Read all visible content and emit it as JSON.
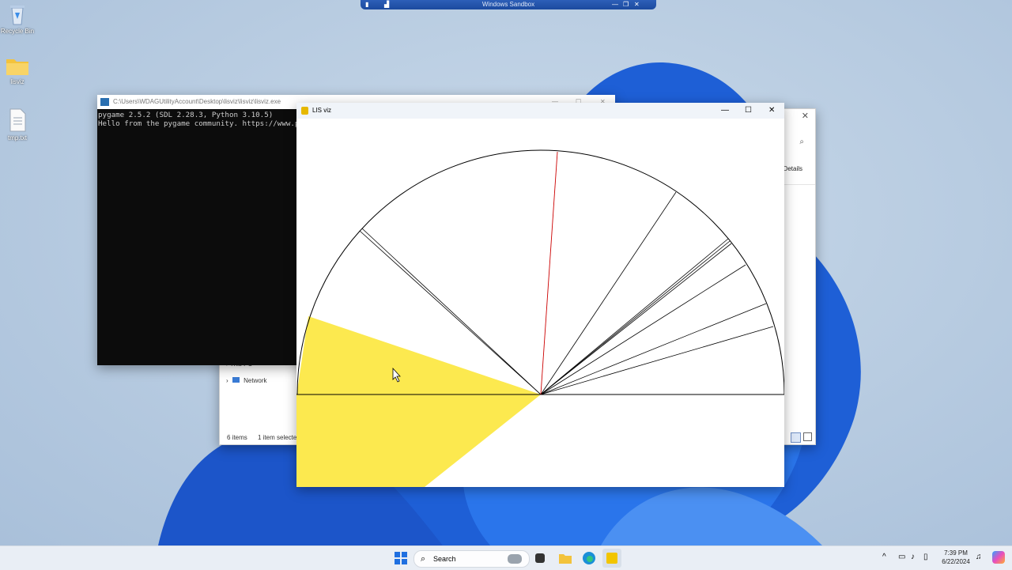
{
  "sandbox": {
    "title": "Windows Sandbox"
  },
  "desktop_icons": [
    {
      "label": "Recycle Bin",
      "icon": "recycle-bin-icon"
    },
    {
      "label": "lisviz",
      "icon": "folder-icon"
    },
    {
      "label": "tmp.txt",
      "icon": "text-file-icon"
    }
  ],
  "console": {
    "title": "C:\\Users\\WDAGUtilityAccount\\Desktop\\lisviz\\lisviz\\lisviz.exe",
    "lines": [
      "pygame 2.5.2 (SDL 2.28.3, Python 3.10.5)",
      "Hello from the pygame community. https://www.py"
    ]
  },
  "explorer": {
    "details_label": "Details",
    "nav_this_pc": "This PC",
    "nav_network": "Network",
    "status_items": "6 items",
    "status_selected": "1 item selecte"
  },
  "pywin": {
    "title": "LIS viz"
  },
  "viz": {
    "center_color": "#fce94f",
    "highlight_color": "#fce94f",
    "red_line_color": "#cc0000"
  },
  "taskbar": {
    "search_placeholder": "Search",
    "time": "7:39 PM",
    "date": "6/22/2024"
  }
}
